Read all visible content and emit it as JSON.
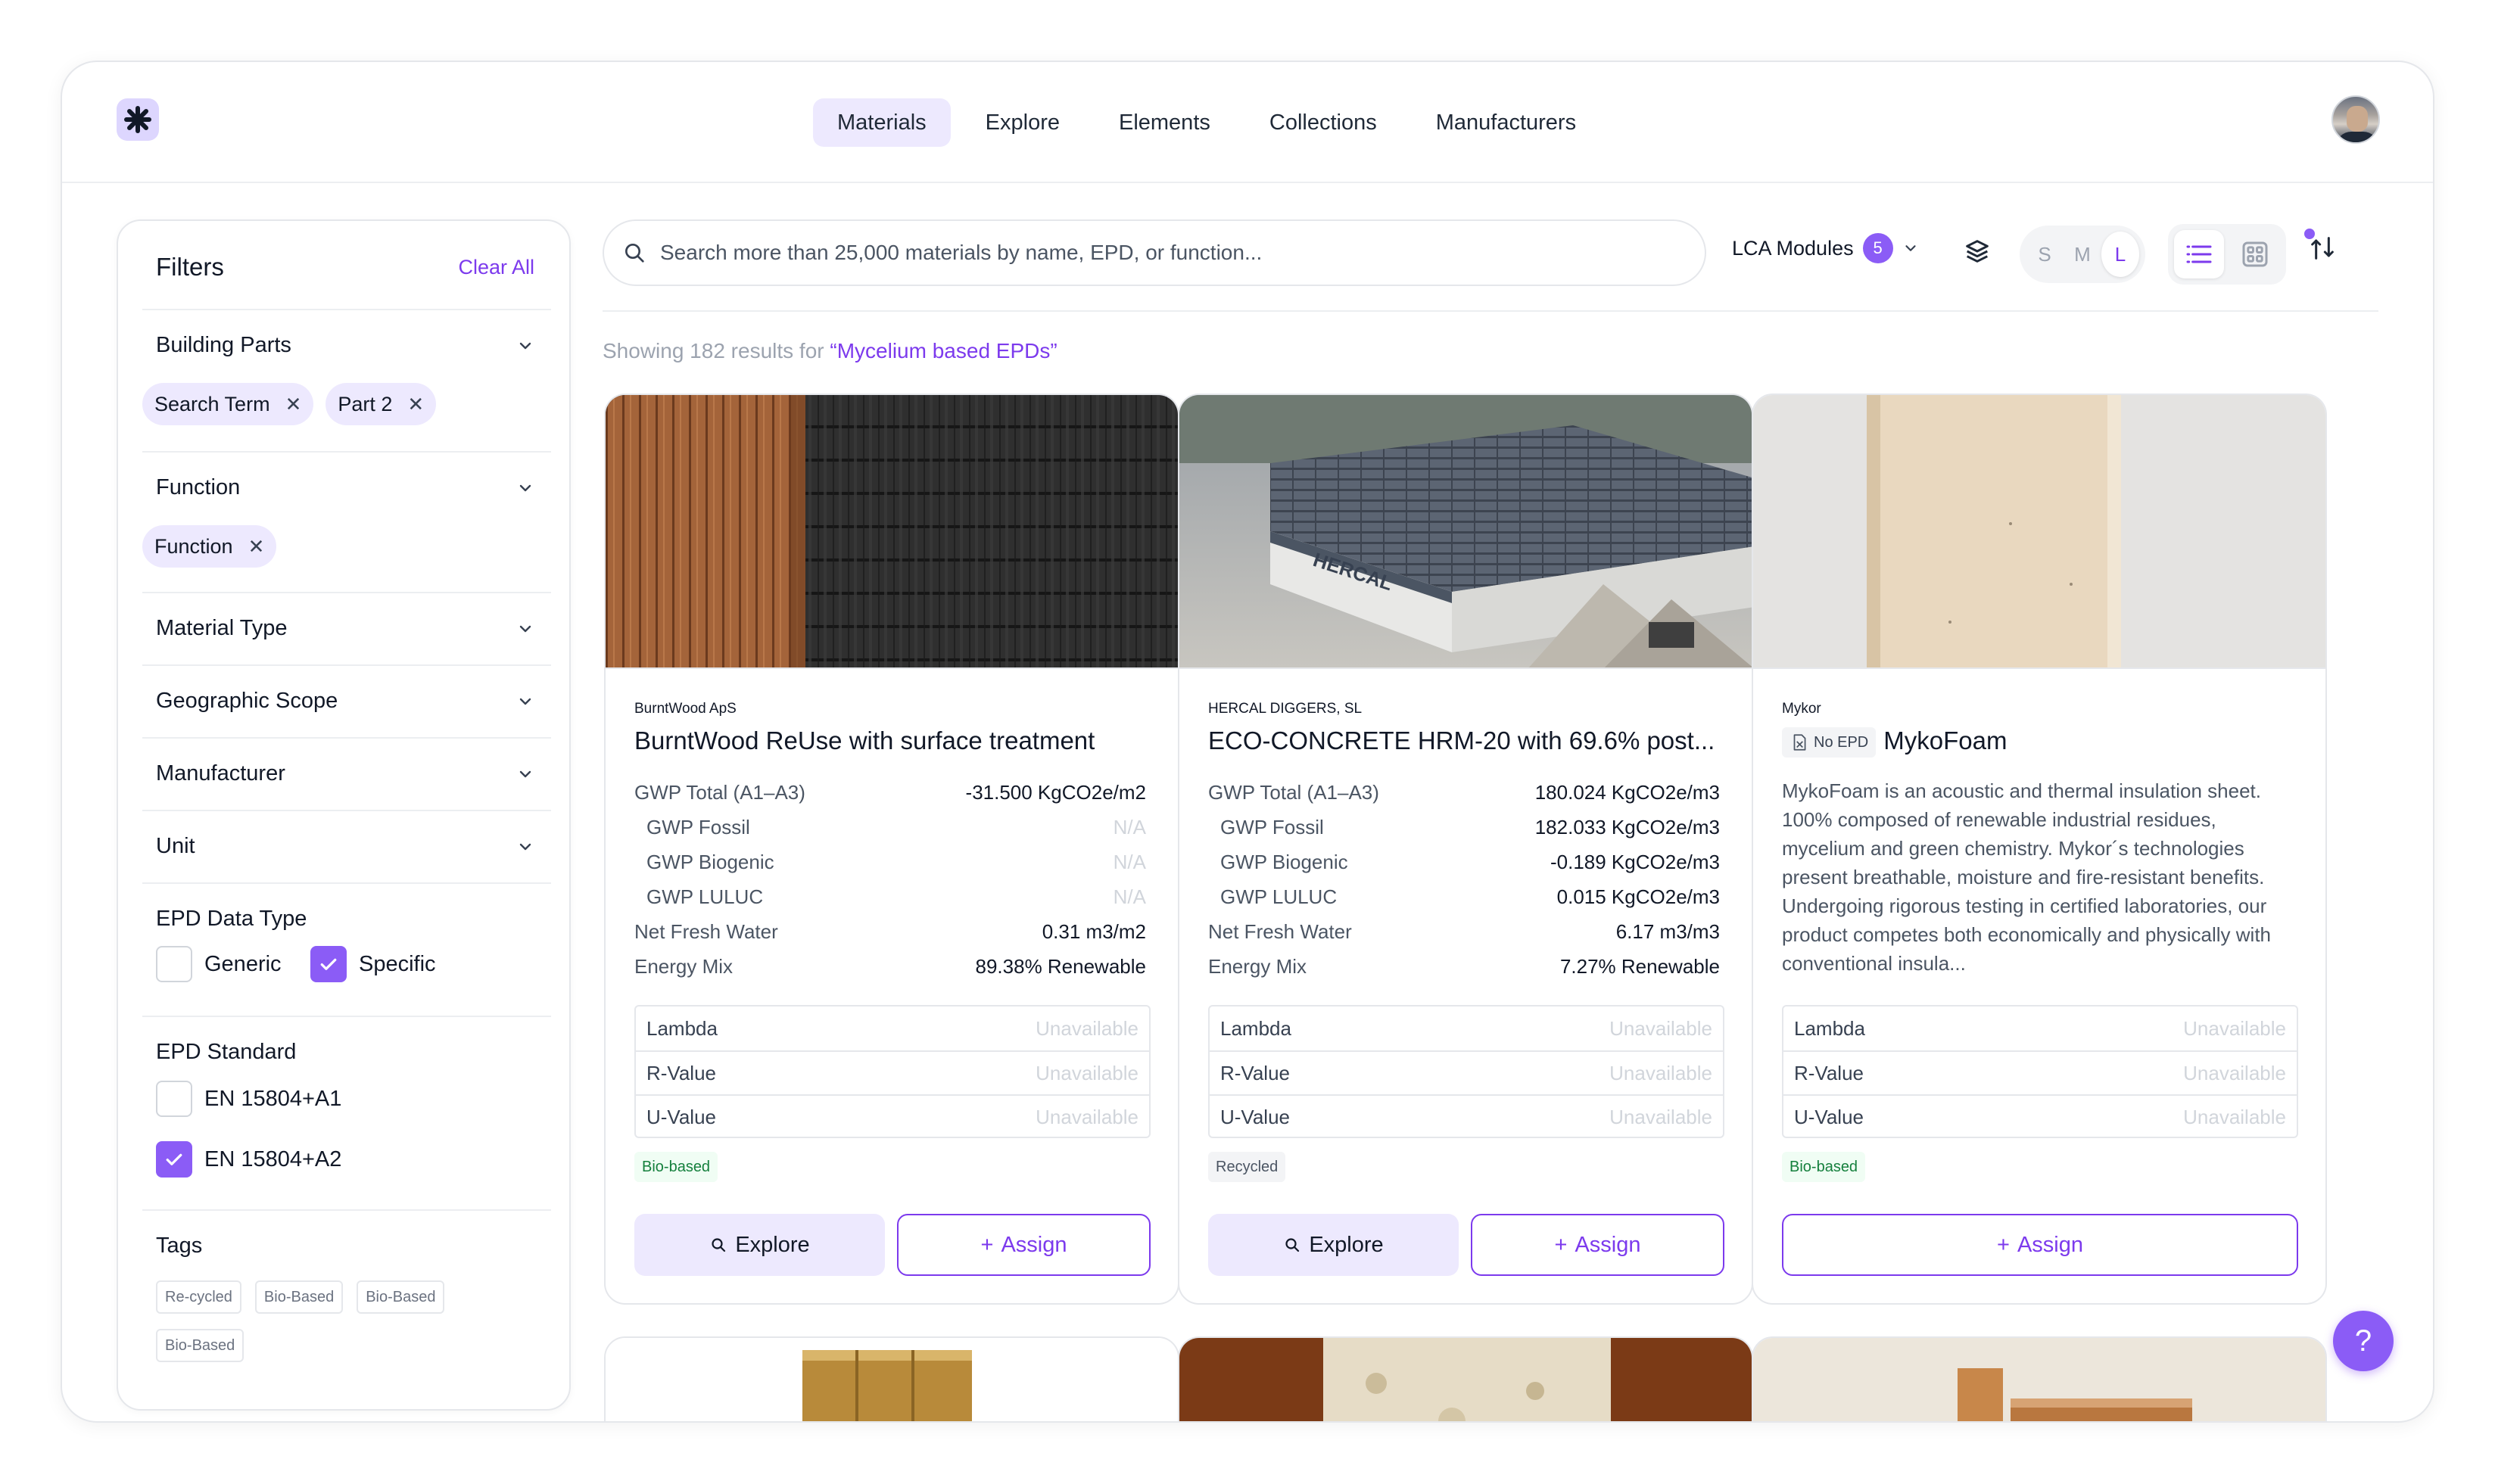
{
  "nav": {
    "tabs": [
      "Materials",
      "Explore",
      "Elements",
      "Collections",
      "Manufacturers"
    ],
    "active": "Materials"
  },
  "filters": {
    "title": "Filters",
    "clear_all": "Clear All",
    "building_parts": {
      "label": "Building Parts",
      "chips": [
        "Search Term",
        "Part 2"
      ]
    },
    "function": {
      "label": "Function",
      "chips": [
        "Function"
      ]
    },
    "material_type": "Material Type",
    "geographic_scope": "Geographic Scope",
    "manufacturer": "Manufacturer",
    "unit": "Unit",
    "epd_data_type": {
      "label": "EPD Data Type",
      "options": [
        {
          "label": "Generic",
          "checked": false
        },
        {
          "label": "Specific",
          "checked": true
        }
      ]
    },
    "epd_standard": {
      "label": "EPD Standard",
      "options": [
        {
          "label": "EN 15804+A1",
          "checked": false
        },
        {
          "label": "EN 15804+A2",
          "checked": true
        }
      ]
    },
    "tags": {
      "label": "Tags",
      "items": [
        "Re-cycled",
        "Bio-Based",
        "Bio-Based",
        "Bio-Based"
      ]
    }
  },
  "search": {
    "placeholder": "Search more than 25,000 materials by name, EPD, or function..."
  },
  "toolbar": {
    "lca_label": "LCA Modules",
    "lca_count": "5",
    "sizes": [
      "S",
      "M",
      "L"
    ],
    "active_size": "L",
    "active_view": "list"
  },
  "results": {
    "prefix": "Showing 182 results for",
    "query": "“Mycelium based EPDs”"
  },
  "cards": [
    {
      "manufacturer": "BurntWood ApS",
      "name": "BurntWood ReUse with surface treatment",
      "stats": [
        {
          "label": "GWP Total (A1–A3)",
          "value": "-31.500 KgCO2e/m2"
        },
        {
          "label": "GWP Fossil",
          "value": "N/A"
        },
        {
          "label": "GWP Biogenic",
          "value": "N/A"
        },
        {
          "label": "GWP LULUC",
          "value": "N/A"
        },
        {
          "label": "Net Fresh Water",
          "value": "0.31 m3/m2"
        },
        {
          "label": "Energy Mix",
          "value": "89.38% Renewable"
        }
      ],
      "props": [
        {
          "label": "Lambda",
          "value": "Unavailable"
        },
        {
          "label": "R-Value",
          "value": "Unavailable"
        },
        {
          "label": "U-Value",
          "value": "Unavailable"
        }
      ],
      "tag": "Bio-based",
      "explore": "Explore",
      "assign": "Assign"
    },
    {
      "manufacturer": "HERCAL DIGGERS, SL",
      "name": "ECO-CONCRETE HRM-20 with 69.6% post...",
      "stats": [
        {
          "label": "GWP Total (A1–A3)",
          "value": "180.024 KgCO2e/m3"
        },
        {
          "label": "GWP Fossil",
          "value": "182.033 KgCO2e/m3"
        },
        {
          "label": "GWP Biogenic",
          "value": "-0.189 KgCO2e/m3"
        },
        {
          "label": "GWP LULUC",
          "value": "0.015 KgCO2e/m3"
        },
        {
          "label": "Net Fresh Water",
          "value": "6.17 m3/m3"
        },
        {
          "label": "Energy Mix",
          "value": "7.27% Renewable"
        }
      ],
      "props": [
        {
          "label": "Lambda",
          "value": "Unavailable"
        },
        {
          "label": "R-Value",
          "value": "Unavailable"
        },
        {
          "label": "U-Value",
          "value": "Unavailable"
        }
      ],
      "tag": "Recycled",
      "explore": "Explore",
      "assign": "Assign",
      "image_sign": "HERCAL"
    },
    {
      "manufacturer": "Mykor",
      "no_epd": "No EPD",
      "name": "MykoFoam",
      "description": "MykoFoam is an acoustic and thermal insulation sheet. 100% composed of renewable industrial residues, mycelium and green chemistry. Mykor´s technologies present breathable, moisture and fire-resistant benefits. Undergoing rigorous testing in certified laboratories, our product competes both economically and physically with conventional insula...",
      "props": [
        {
          "label": "Lambda",
          "value": "Unavailable"
        },
        {
          "label": "R-Value",
          "value": "Unavailable"
        },
        {
          "label": "U-Value",
          "value": "Unavailable"
        }
      ],
      "tag": "Bio-based",
      "assign": "Assign"
    }
  ],
  "help": "?",
  "colors": {
    "accent": "#7c3aed",
    "accent_light": "#ede9fe",
    "badge": "#8b5cf6",
    "bio_green": "#15803d"
  },
  "icons": [
    "asterisk-logo-icon",
    "search-icon",
    "chevron-down-icon",
    "close-icon",
    "layers-icon",
    "list-view-icon",
    "grid-view-icon",
    "sort-icon",
    "plus-icon",
    "no-epd-icon",
    "check-icon",
    "help-icon"
  ]
}
